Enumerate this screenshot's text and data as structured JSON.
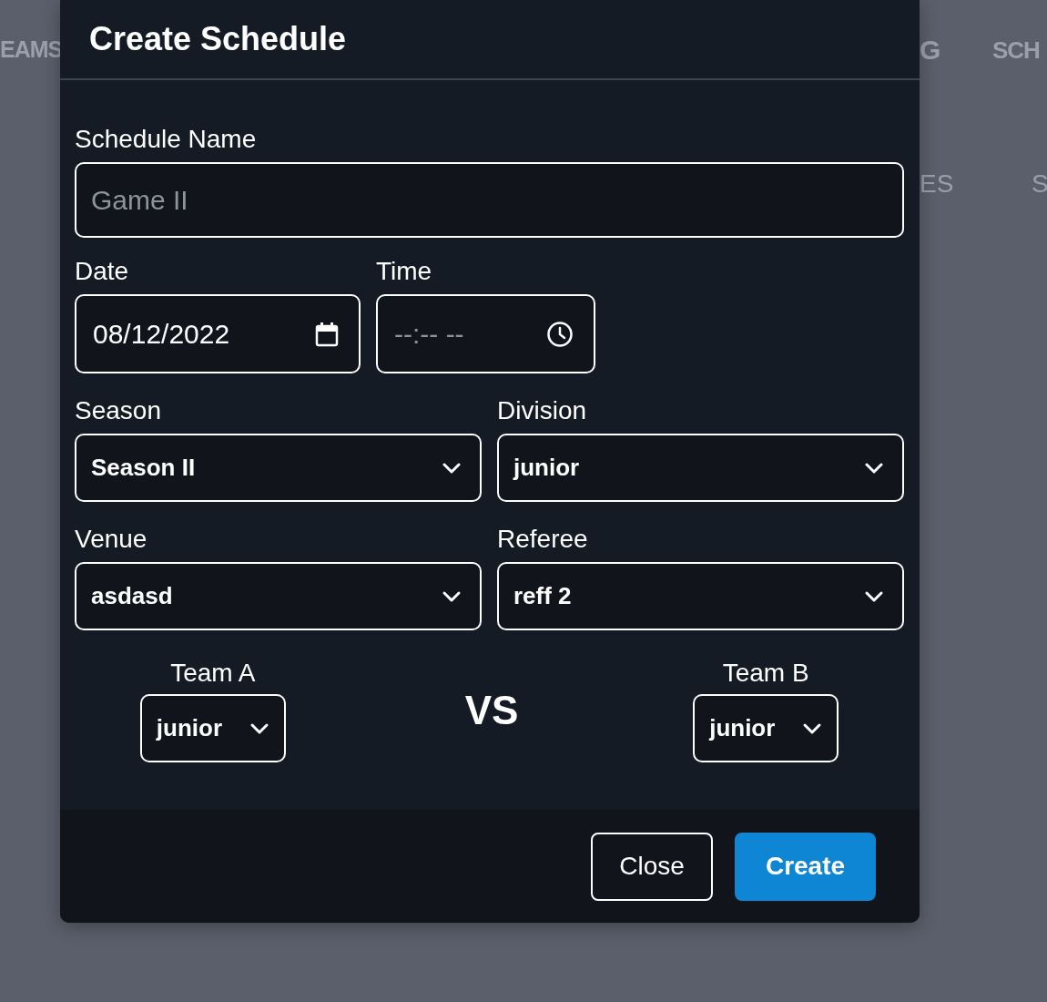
{
  "background_nav": [
    {
      "text": "EAMS"
    },
    {
      "text": "G"
    },
    {
      "text": "SCH"
    },
    {
      "text": "ES"
    },
    {
      "text": "S"
    }
  ],
  "dialog": {
    "title": "Create Schedule",
    "schedule_name": {
      "label": "Schedule Name",
      "placeholder": "Game II"
    },
    "date": {
      "label": "Date",
      "value": "08/12/2022"
    },
    "time": {
      "label": "Time",
      "placeholder": "--:-- --"
    },
    "selects": [
      {
        "label": "Season",
        "value": "Season II"
      },
      {
        "label": "Division",
        "value": "junior"
      },
      {
        "label": "Venue",
        "value": "asdasd"
      },
      {
        "label": "Referee",
        "value": "reff 2"
      }
    ],
    "team_a": {
      "label": "Team A",
      "value": "junior"
    },
    "versus": "VS",
    "team_b": {
      "label": "Team B",
      "value": "junior"
    },
    "buttons": [
      {
        "label": "Close",
        "kind": "secondary"
      },
      {
        "label": "Create",
        "kind": "primary"
      }
    ]
  }
}
